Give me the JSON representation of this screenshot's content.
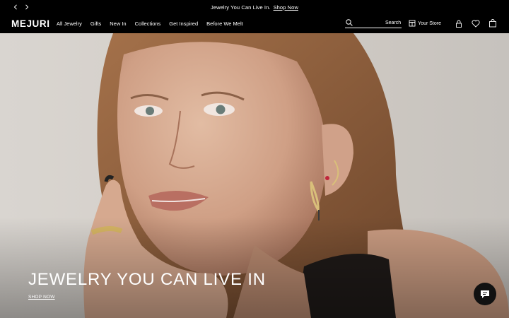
{
  "announcement": {
    "message": "Jewelry You Can Live In.",
    "link": "Shop Now",
    "prev_icon": "chevron-left-icon",
    "next_icon": "chevron-right-icon"
  },
  "header": {
    "logo": "MEJURI",
    "menu": [
      "All Jewelry",
      "Gifts",
      "New In",
      "Collections",
      "Get Inspired",
      "Before We Melt"
    ],
    "search_placeholder": "Search",
    "store_label": "Your Store",
    "icons": [
      "search-icon",
      "store-icon",
      "account-icon",
      "wishlist-icon",
      "bag-icon"
    ]
  },
  "hero": {
    "title": "JEWELRY YOU CAN LIVE IN",
    "cta": "SHOP NOW"
  },
  "chat": {
    "icon": "chat-icon"
  },
  "colors": {
    "background": "#000000",
    "text": "#ffffff",
    "hero_bg": "#d4cfc9"
  }
}
